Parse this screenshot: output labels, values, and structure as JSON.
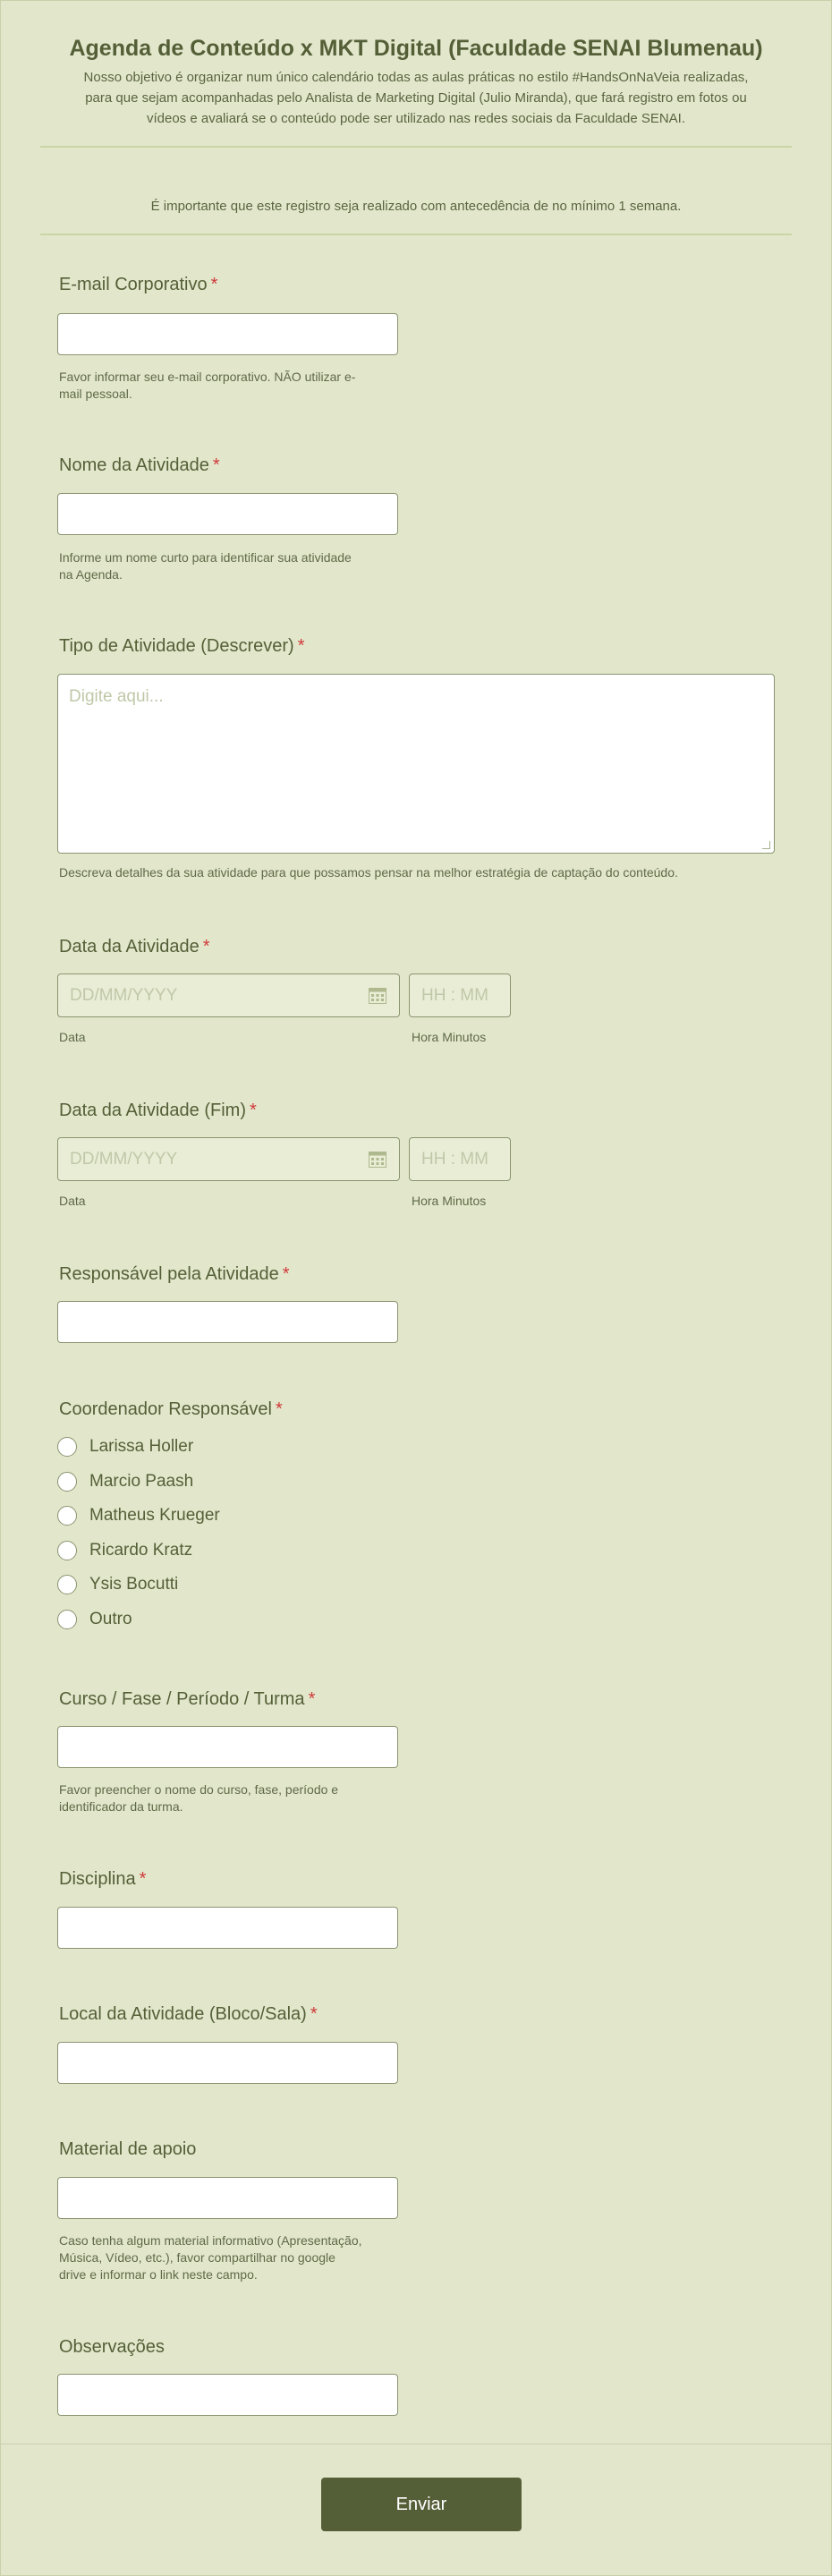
{
  "header": {
    "title": "Agenda de Conteúdo x MKT Digital (Faculdade SENAI Blumenau)",
    "description_lines": [
      "Nosso objetivo é organizar num único calendário todas as aulas práticas no estilo #HandsOnNaVeia realizadas,",
      "para que sejam acompanhadas pelo Analista de Marketing Digital (Julio Miranda), que fará registro em fotos ou",
      "vídeos e avaliará se o conteúdo pode ser utilizado nas redes sociais da Faculdade SENAI."
    ],
    "note": "É importante que este registro seja realizado com antecedência de no mínimo 1 semana."
  },
  "fields": {
    "email": {
      "label": "E-mail Corporativo",
      "required": "*",
      "value": "",
      "help_lines": [
        "Favor informar seu e-mail corporativo. NÃO utilizar e-",
        "mail pessoal."
      ]
    },
    "activity_name": {
      "label": "Nome da Atividade",
      "required": "*",
      "value": "",
      "help_lines": [
        "Informe um nome curto para identificar sua atividade",
        "na Agenda."
      ]
    },
    "activity_type": {
      "label": "Tipo de Atividade (Descrever)",
      "required": "*",
      "placeholder": "Digite aqui...",
      "help": "Descreva detalhes da sua atividade para que possamos pensar na melhor estratégia de captação do conteúdo."
    },
    "activity_date": {
      "label": "Data da Atividade",
      "required": "*",
      "date_placeholder": "DD/MM/YYYY",
      "time_placeholder": "HH : MM",
      "date_sublabel": "Data",
      "time_sublabel": "Hora Minutos"
    },
    "activity_date_end": {
      "label": "Data da Atividade (Fim)",
      "required": "*",
      "date_placeholder": "DD/MM/YYYY",
      "time_placeholder": "HH : MM",
      "date_sublabel": "Data",
      "time_sublabel": "Hora Minutos"
    },
    "responsible": {
      "label": "Responsável pela Atividade",
      "required": "*",
      "value": ""
    },
    "coordinator": {
      "label": "Coordenador Responsável",
      "required": "*",
      "options": [
        "Larissa Holler",
        "Marcio Paash",
        "Matheus Krueger",
        "Ricardo Kratz",
        "Ysis Bocutti",
        "Outro"
      ]
    },
    "course": {
      "label": "Curso / Fase / Período / Turma",
      "required": "*",
      "value": "",
      "help_lines": [
        "Favor preencher o nome do curso, fase, período e",
        "identificador da turma."
      ]
    },
    "discipline": {
      "label": "Disciplina",
      "required": "*",
      "value": ""
    },
    "location": {
      "label": "Local da Atividade (Bloco/Sala)",
      "required": "*",
      "value": ""
    },
    "support_material": {
      "label": "Material de apoio",
      "value": "",
      "help_lines": [
        "Caso tenha algum material informativo (Apresentação,",
        "Música, Vídeo, etc.), favor compartilhar no google",
        "drive e informar o link neste campo."
      ]
    },
    "observations": {
      "label": "Observações",
      "value": ""
    }
  },
  "submit": {
    "label": "Enviar"
  },
  "colors": {
    "background": "#e2e7cc",
    "accent": "#555f37",
    "required": "#d03a3a",
    "divider": "#c9d6a4"
  },
  "icons": {
    "calendar": "calendar-icon"
  }
}
